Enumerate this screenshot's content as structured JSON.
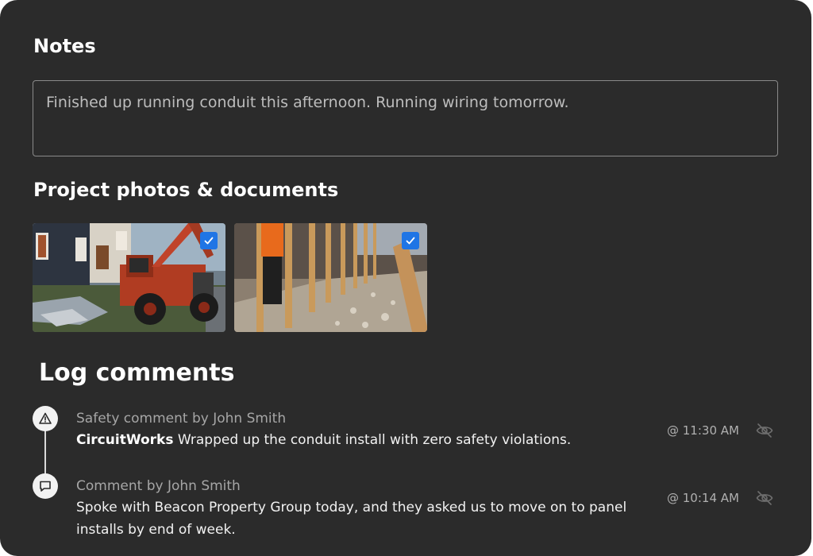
{
  "notes": {
    "title": "Notes",
    "text": "Finished up running conduit this afternoon. Running wiring tomorrow."
  },
  "photos": {
    "title": "Project photos & documents",
    "items": [
      {
        "label": "Red telehandler lift beside house",
        "selected": true
      },
      {
        "label": "Wood stud wall framing with worker",
        "selected": true
      }
    ]
  },
  "log": {
    "title": "Log comments",
    "comments": [
      {
        "icon": "warning-triangle-icon",
        "meta": "Safety comment by John Smith",
        "company": "CircuitWorks",
        "body": "Wrapped up the conduit install with zero safety violations.",
        "time": "@ 11:30 AM",
        "action_icon": "eye-off-icon"
      },
      {
        "icon": "comment-bubble-icon",
        "meta": "Comment by John Smith",
        "company": "",
        "body": "Spoke with Beacon Property Group today, and they asked us to move on to panel installs by end of week.",
        "time": "@ 10:14 AM",
        "action_icon": "eye-off-icon"
      }
    ]
  },
  "colors": {
    "background": "#2b2b2b",
    "checkbox": "#1f75e5",
    "text": "#f2f2f2",
    "muted": "#a6a6a6"
  }
}
